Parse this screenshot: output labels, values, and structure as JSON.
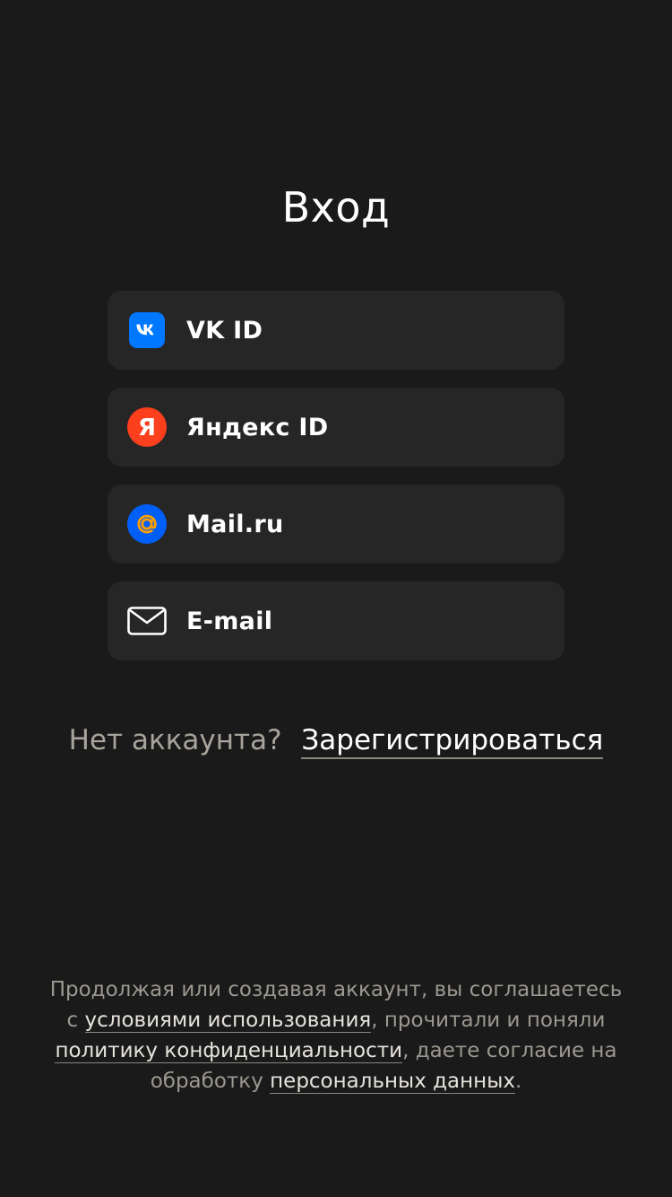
{
  "title": "Вход",
  "providers": [
    {
      "label": "VK ID",
      "icon": "vk-logo-icon",
      "color": "#0077ff"
    },
    {
      "label": "Яндекс ID",
      "icon": "yandex-logo-icon",
      "color": "#fc3f1d"
    },
    {
      "label": "Mail.ru",
      "icon": "mailru-logo-icon",
      "color": "#005ff9"
    },
    {
      "label": "E-mail",
      "icon": "envelope-icon",
      "color": "#ffffff"
    }
  ],
  "register": {
    "prompt": "Нет аккаунта?",
    "link": "Зарегистрироваться"
  },
  "legal": {
    "part1": "Продолжая или создавая аккаунт, вы соглашаетесь с ",
    "terms_link": "условиями использования",
    "part2": ", прочитали и поняли ",
    "privacy_link": "политику конфиденциальности",
    "part3": ", даете согласие на обработку ",
    "data_link": "персональных данных",
    "part4": "."
  },
  "colors": {
    "background": "#1a1a1a",
    "button": "#262626",
    "muted_text": "#a8a49c"
  }
}
